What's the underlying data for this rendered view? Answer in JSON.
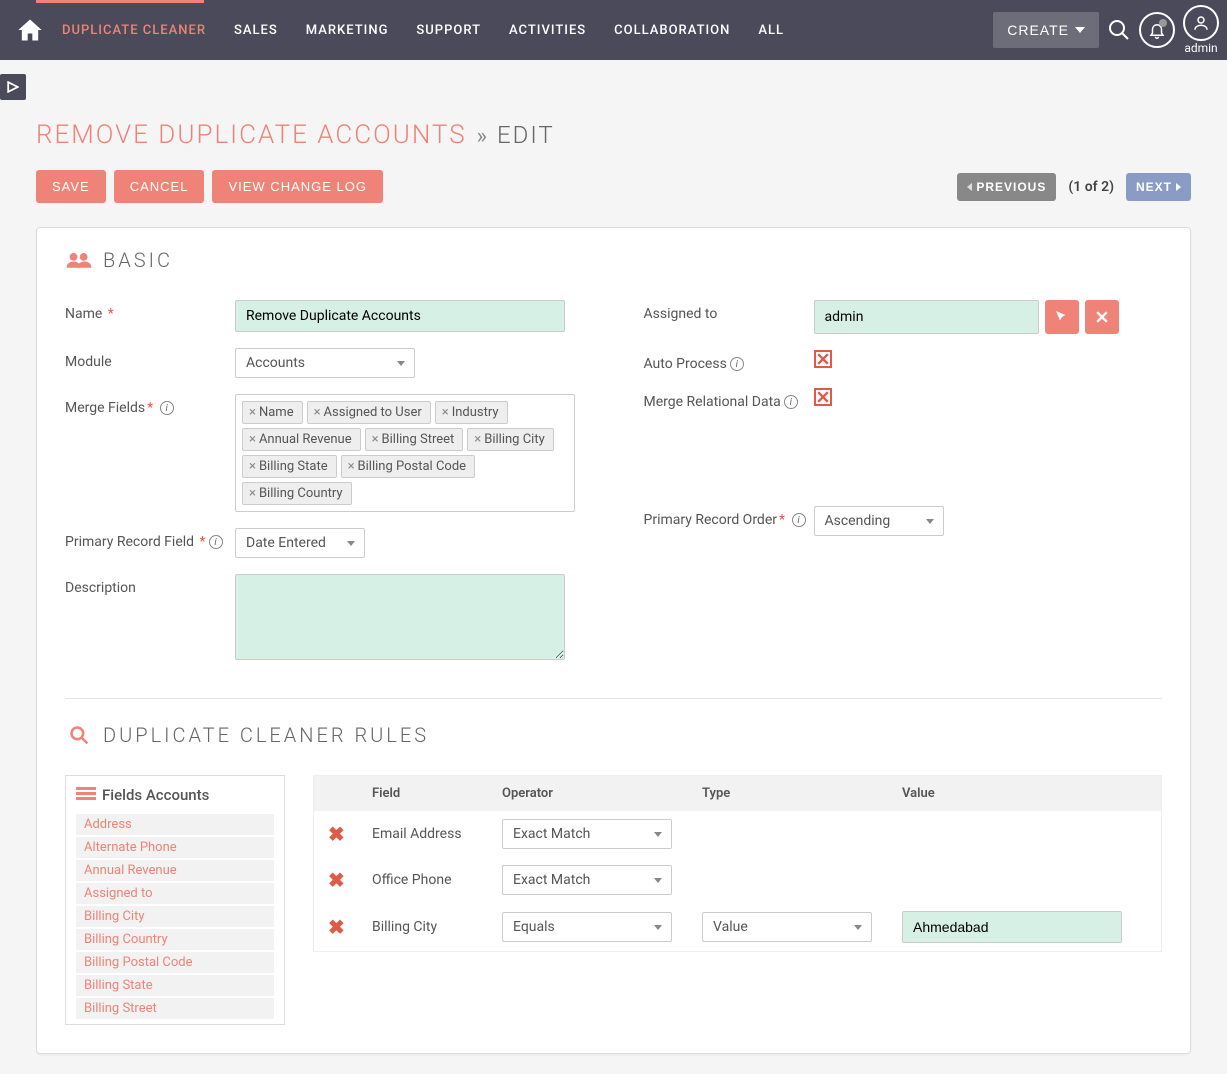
{
  "topnav": {
    "items": [
      "DUPLICATE CLEANER",
      "SALES",
      "MARKETING",
      "SUPPORT",
      "ACTIVITIES",
      "COLLABORATION",
      "ALL"
    ],
    "active": 0,
    "create_label": "CREATE",
    "username": "admin"
  },
  "page": {
    "title_main": "REMOVE DUPLICATE ACCOUNTS",
    "title_sep": "»",
    "title_sub": "EDIT"
  },
  "actions": {
    "save": "SAVE",
    "cancel": "CANCEL",
    "view_log": "VIEW CHANGE LOG",
    "prev": "PREVIOUS",
    "next": "NEXT",
    "pager": "(1 of 2)"
  },
  "basic": {
    "header": "BASIC",
    "name_label": "Name",
    "name_value": "Remove Duplicate Accounts",
    "module_label": "Module",
    "module_value": "Accounts",
    "merge_label": "Merge Fields",
    "merge_tags": [
      "Name",
      "Assigned to User",
      "Industry",
      "Annual Revenue",
      "Billing Street",
      "Billing City",
      "Billing State",
      "Billing Postal Code",
      "Billing Country"
    ],
    "primary_field_label": "Primary Record Field",
    "primary_field_value": "Date Entered",
    "description_label": "Description",
    "description_value": "",
    "assigned_label": "Assigned to",
    "assigned_value": "admin",
    "auto_label": "Auto Process",
    "merge_rel_label": "Merge Relational Data",
    "primary_order_label": "Primary Record Order",
    "primary_order_value": "Ascending"
  },
  "rules": {
    "header": "DUPLICATE CLEANER RULES",
    "fields_header": "Fields Accounts",
    "field_list": [
      "Address",
      "Alternate Phone",
      "Annual Revenue",
      "Assigned to",
      "Billing City",
      "Billing Country",
      "Billing Postal Code",
      "Billing State",
      "Billing Street"
    ],
    "columns": {
      "field": "Field",
      "operator": "Operator",
      "type": "Type",
      "value": "Value"
    },
    "rows": [
      {
        "field": "Email Address",
        "operator": "Exact Match",
        "type": "",
        "value": ""
      },
      {
        "field": "Office Phone",
        "operator": "Exact Match",
        "type": "",
        "value": ""
      },
      {
        "field": "Billing City",
        "operator": "Equals",
        "type": "Value",
        "value": "Ahmedabad"
      }
    ]
  }
}
